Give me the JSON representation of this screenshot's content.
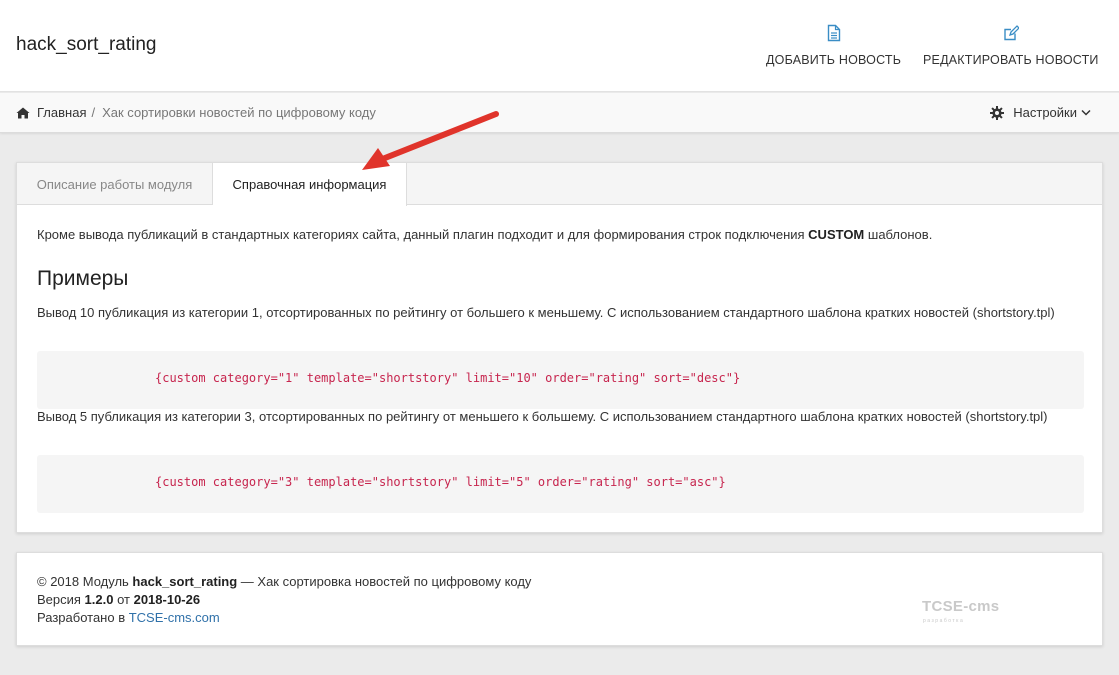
{
  "app": {
    "title": "hack_sort_rating"
  },
  "top_actions": [
    {
      "label": "ДОБАВИТЬ НОВОСТЬ",
      "icon": "file-text-icon"
    },
    {
      "label": "РЕДАКТИРОВАТЬ НОВОСТИ",
      "icon": "edit-icon"
    }
  ],
  "breadcrumb": {
    "home": "Главная",
    "separator": "/",
    "current": "Хак сортировки новостей по цифровому коду"
  },
  "settings": {
    "label": "Настройки"
  },
  "tabs": [
    {
      "label": "Описание работы модуля",
      "active": false
    },
    {
      "label": "Справочная информация",
      "active": true
    }
  ],
  "content": {
    "intro_before": "Кроме вывода публикаций в стандартных категориях сайта, данный плагин подходит и для формирования строк подключения ",
    "intro_bold": "CUSTOM",
    "intro_after": " шаблонов.",
    "examples_heading": "Примеры",
    "examples": [
      {
        "text": "Вывод 10 публикация из категории 1, отсортированных по рейтингу от большего к меньшему. С использованием стандартного шаблона кратких новостей (shortstory.tpl)",
        "code": "{custom category=\"1\" template=\"shortstory\" limit=\"10\" order=\"rating\" sort=\"desc\"}"
      },
      {
        "text": "Вывод 5 публикация из категории 3, отсортированных по рейтингу от меньшего к большему. С использованием стандартного шаблона кратких новостей (shortstory.tpl)",
        "code": "{custom category=\"3\" template=\"shortstory\" limit=\"5\" order=\"rating\" sort=\"asc\"}"
      }
    ]
  },
  "footer": {
    "line1_prefix": "© 2018 Модуль ",
    "line1_module": "hack_sort_rating",
    "line1_suffix": " — Хак сортировка новостей по цифровому коду",
    "line2_prefix": "Версия ",
    "line2_version": "1.2.0",
    "line2_mid": " от ",
    "line2_date": "2018-10-26",
    "line3_prefix": "Разработано в ",
    "line3_link": "TCSE-cms.com",
    "logo_text": "TCSE-cms",
    "logo_subtext": "разработка"
  },
  "colors": {
    "annotation_arrow": "#e0342b",
    "code_text": "#c7254e",
    "link": "#3071a9"
  }
}
